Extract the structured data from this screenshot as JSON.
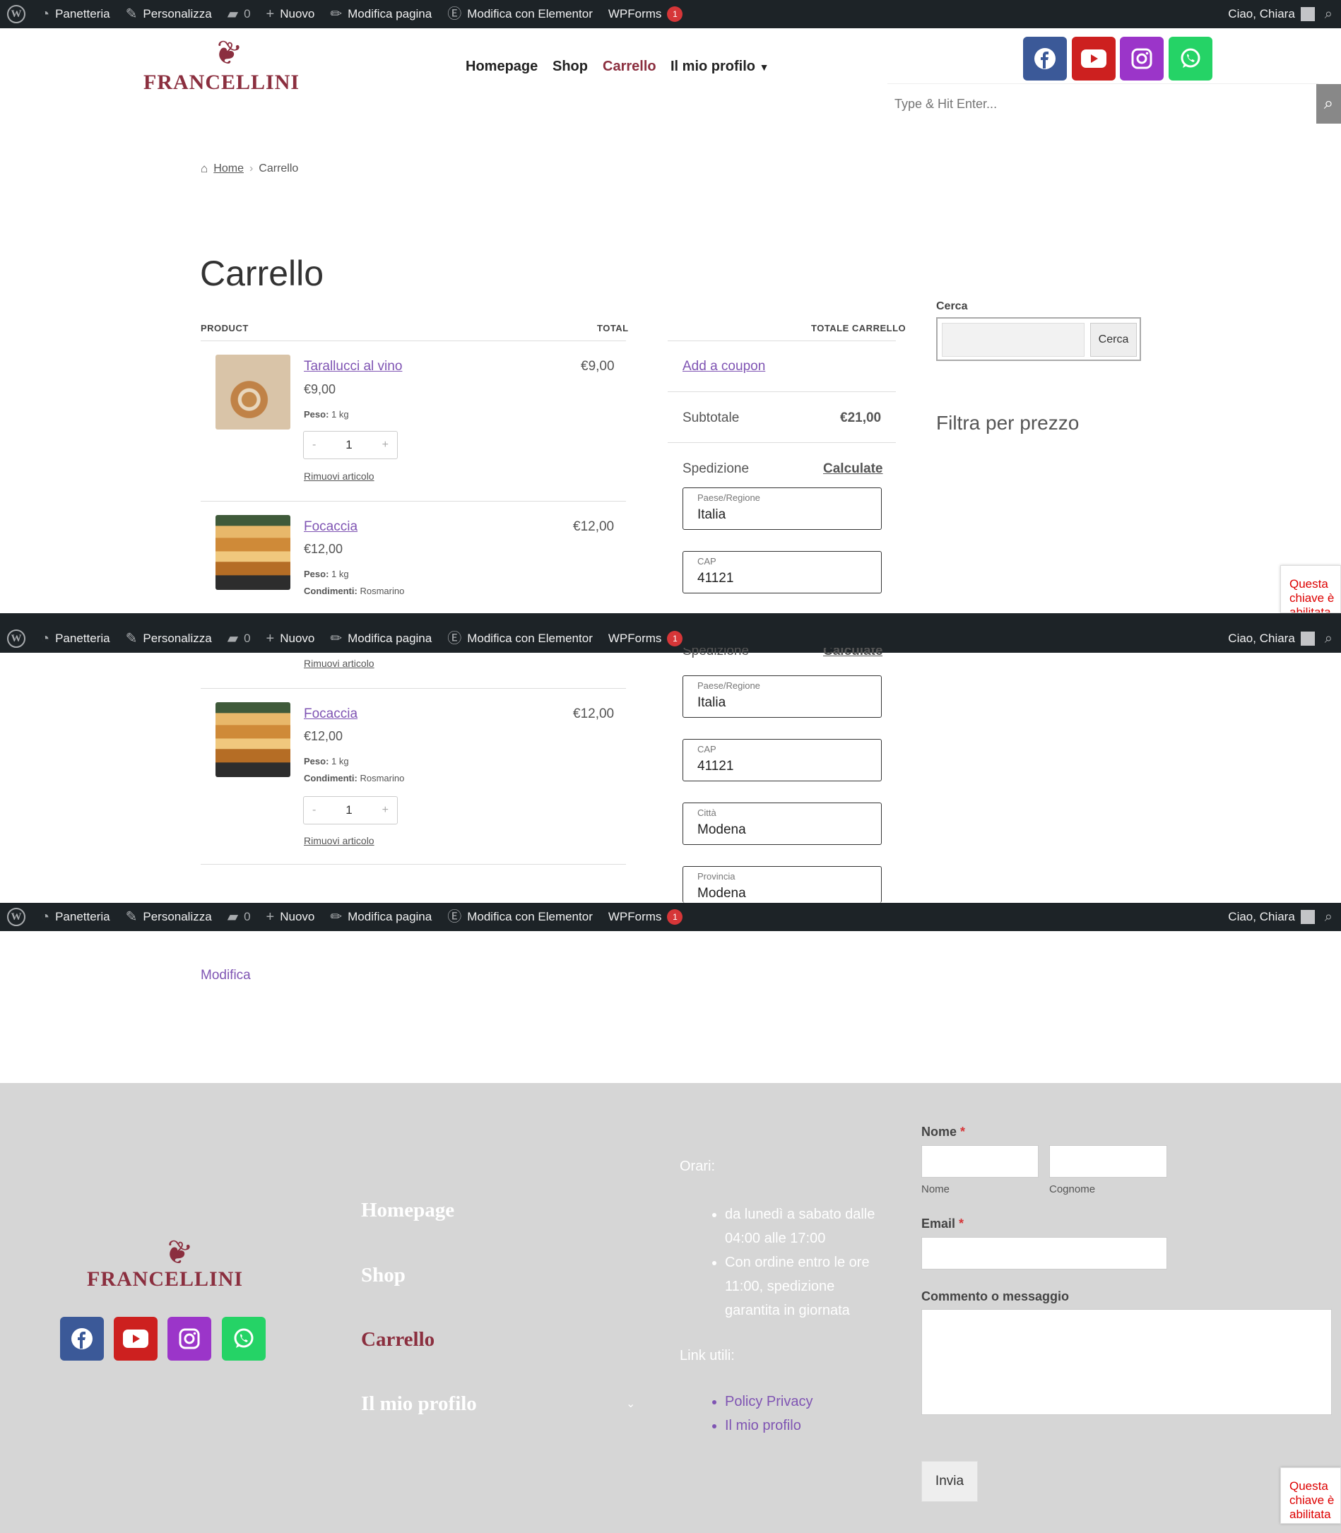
{
  "admin_bar": {
    "site_name": "Panetteria",
    "customize": "Personalizza",
    "comments_count": "0",
    "new": "Nuovo",
    "edit_page": "Modifica pagina",
    "edit_elementor": "Modifica con Elementor",
    "wpforms": "WPForms",
    "wpforms_badge": "1",
    "greeting": "Ciao, Chiara"
  },
  "header": {
    "logo_text": "FRANCELLINI",
    "nav": [
      "Homepage",
      "Shop",
      "Carrello",
      "Il mio profilo"
    ],
    "active_nav": "Carrello",
    "search_placeholder": "Type & Hit Enter..."
  },
  "breadcrumb": {
    "home": "Home",
    "current": "Carrello"
  },
  "page_title": "Carrello",
  "cart": {
    "col_product": "PRODUCT",
    "col_total": "TOTAL",
    "items": [
      {
        "name": "Tarallucci al vino",
        "price": "€9,00",
        "total": "€9,00",
        "meta": [
          {
            "key": "Peso:",
            "value": "1 kg"
          }
        ],
        "qty": "1",
        "remove": "Rimuovi articolo"
      },
      {
        "name": "Focaccia",
        "price": "€12,00",
        "total": "€12,00",
        "meta": [
          {
            "key": "Peso:",
            "value": "1 kg"
          },
          {
            "key": "Condimenti:",
            "value": "Rosmarino"
          }
        ],
        "qty": "1",
        "remove": "Rimuovi articolo"
      }
    ]
  },
  "totals": {
    "heading": "TOTALE CARRELLO",
    "coupon": "Add a coupon",
    "subtotal_label": "Subtotale",
    "subtotal_value": "€21,00",
    "shipping_label": "Spedizione",
    "calculate": "Calculate",
    "fields": [
      {
        "label": "Paese/Regione",
        "value": "Italia"
      },
      {
        "label": "CAP",
        "value": "41121"
      },
      {
        "label": "Città",
        "value": "Modena"
      },
      {
        "label": "Provincia",
        "value": "Modena"
      }
    ]
  },
  "sidebar": {
    "search_title": "Cerca",
    "search_button": "Cerca",
    "filter_title": "Filtra per prezzo"
  },
  "edit_link": "Modifica",
  "recaptcha_text": "Questa chiave è abilitata per reCAPTCHA invisibile.",
  "footer": {
    "logo_text": "FRANCELLINI",
    "nav": [
      "Homepage",
      "Shop",
      "Carrello",
      "Il mio profilo"
    ],
    "hours_title": "Orari:",
    "hours": [
      "da lunedì a sabato dalle 04:00 alle 17:00",
      "Con ordine entro le ore 11:00, spedizione garantita in giornata"
    ],
    "links_title": "Link utili:",
    "links": [
      "Policy Privacy",
      "Il mio profilo"
    ],
    "form": {
      "name_label": "Nome",
      "first_label": "Nome",
      "last_label": "Cognome",
      "email_label": "Email",
      "message_label": "Commento o messaggio",
      "required_mark": "*",
      "submit": "Invia"
    }
  },
  "colors": {
    "brand": "#8b2f3f",
    "link": "#7f54b3",
    "admin_bar": "#1d2327",
    "footer_bg": "#d6d6d6"
  },
  "icons": [
    "wordpress-icon",
    "dashboard-icon",
    "brush-icon",
    "comment-icon",
    "plus-icon",
    "pencil-icon",
    "elementor-icon",
    "search-icon",
    "facebook-icon",
    "youtube-icon",
    "instagram-icon",
    "whatsapp-icon",
    "home-icon",
    "chevron-down-icon"
  ]
}
